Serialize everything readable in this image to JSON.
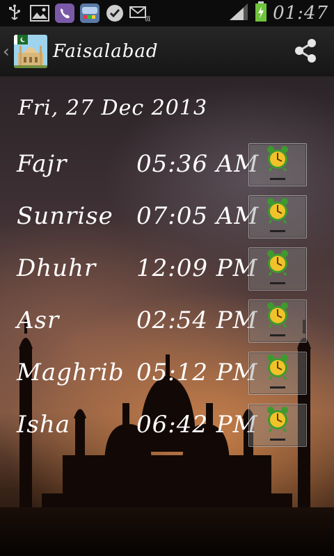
{
  "status_bar": {
    "time": "01:47",
    "icons": [
      "usb-icon",
      "gallery-icon",
      "viber-icon",
      "game-icon",
      "check-icon",
      "mail-icon",
      "signal-icon",
      "battery-charging-icon"
    ]
  },
  "action_bar": {
    "title": "Faisalabad",
    "back_glyph": "‹",
    "share_icon": "share-icon"
  },
  "content": {
    "date": "Fri, 27 Dec 2013",
    "prayers": [
      {
        "name": "Fajr",
        "time": "05:36 AM"
      },
      {
        "name": "Sunrise",
        "time": "07:05 AM"
      },
      {
        "name": "Dhuhr",
        "time": "12:09 PM"
      },
      {
        "name": "Asr",
        "time": "02:54 PM"
      },
      {
        "name": "Maghrib",
        "time": "05:12 PM"
      },
      {
        "name": "Isha",
        "time": "06:42 PM"
      }
    ],
    "alarm_icon": "alarm-clock-icon"
  },
  "colors": {
    "text": "#ffffff",
    "clock_yellow": "#f2c22a",
    "clock_green": "#3e9a2e"
  }
}
